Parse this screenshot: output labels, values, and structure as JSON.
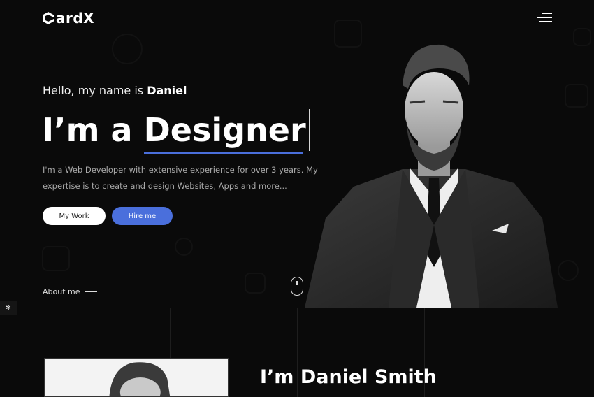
{
  "brand": {
    "logo_text": "ardX",
    "logo_icon": "cube-logo-icon"
  },
  "header": {
    "menu_icon": "hamburger-menu-icon"
  },
  "hero": {
    "greeting_prefix": "Hello, my name is ",
    "greeting_name": "Daniel",
    "headline_prefix": "I’m a ",
    "headline_role": "Designer",
    "intro": "I'm a Web Developer with extensive experience for over 3 years. My expertise is to create and design Websites, Apps and more...",
    "buttons": {
      "work": "My Work",
      "hire": "Hire me"
    },
    "scroll_icon": "mouse-scroll-icon"
  },
  "about": {
    "section_label": "About me",
    "name_heading": "I’m Daniel Smith"
  },
  "side_tool_icon": "bug-icon",
  "colors": {
    "accent": "#4a6fdc",
    "background": "#0a0a0a",
    "button_light": "#ffffff"
  }
}
